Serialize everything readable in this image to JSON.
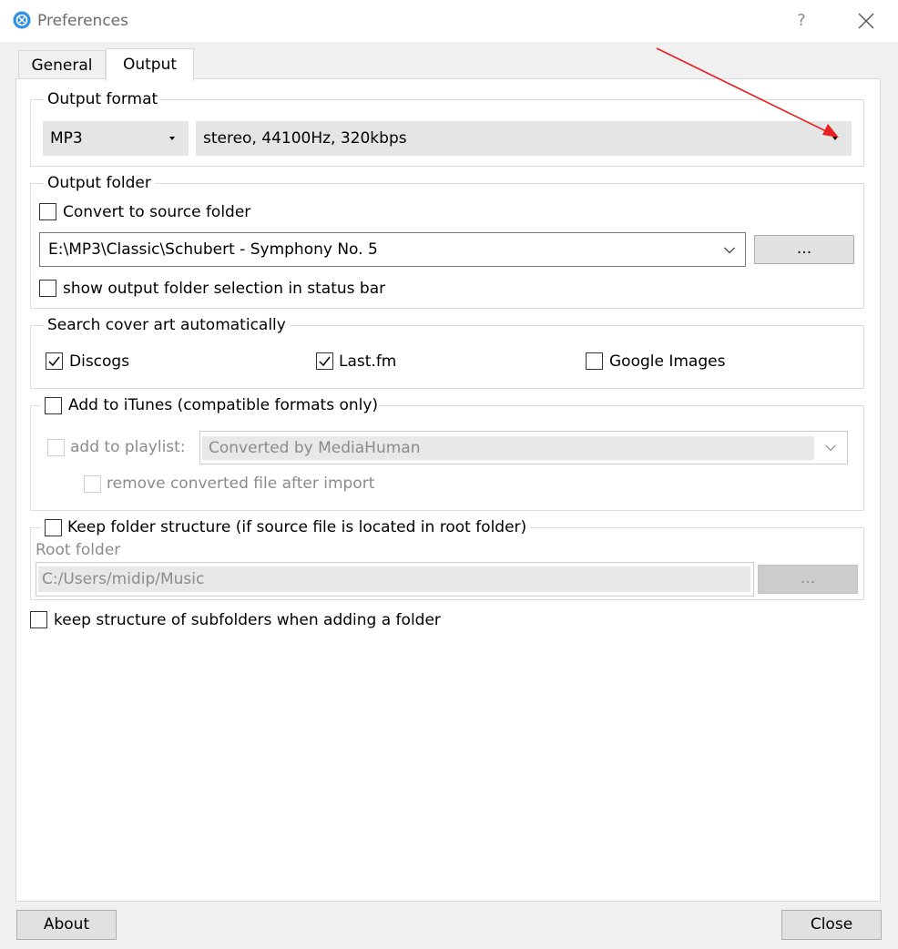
{
  "window": {
    "title": "Preferences",
    "help_label": "?"
  },
  "tabs": [
    {
      "label": "General",
      "active": false
    },
    {
      "label": "Output",
      "active": true
    }
  ],
  "output_format": {
    "group_title": "Output format",
    "format_value": "MP3",
    "quality_value": "stereo, 44100Hz, 320kbps"
  },
  "output_folder": {
    "group_title": "Output folder",
    "convert_to_source_label": "Convert to source folder",
    "convert_to_source_checked": false,
    "path_value": "E:\\MP3\\Classic\\Schubert - Symphony No. 5",
    "browse_label": "...",
    "show_in_status_bar_label": "show output folder selection in status bar",
    "show_in_status_bar_checked": false
  },
  "cover_art": {
    "group_title": "Search cover art automatically",
    "discogs_label": "Discogs",
    "discogs_checked": true,
    "lastfm_label": "Last.fm",
    "lastfm_checked": true,
    "google_label": "Google Images",
    "google_checked": false
  },
  "itunes": {
    "group_title": "Add to iTunes (compatible formats only)",
    "checked": false,
    "add_to_playlist_label": "add to playlist:",
    "playlist_value": "Converted by MediaHuman",
    "remove_after_import_label": "remove converted file after import"
  },
  "folder_structure": {
    "group_title": "Keep folder structure (if source file is located in root folder)",
    "checked": false,
    "root_folder_label": "Root folder",
    "root_folder_value": "C:/Users/midip/Music",
    "browse_label": "..."
  },
  "subfolders": {
    "label": "keep structure of subfolders when adding a folder",
    "checked": false
  },
  "footer": {
    "about_label": "About",
    "close_label": "Close"
  },
  "colors": {
    "annotation_arrow": "#e82020",
    "check_mark": "#000000",
    "app_icon": "#2f8fe0"
  }
}
